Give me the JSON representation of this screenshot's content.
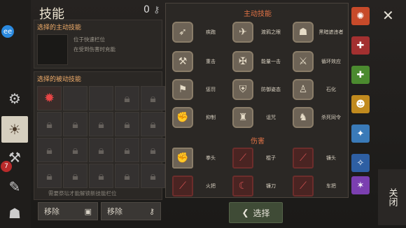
{
  "header": {
    "title": "技能",
    "count": "0"
  },
  "active": {
    "label": "选择的主动技能",
    "note1": "位于快速栏位",
    "note2": "在受到伤害时充能"
  },
  "passive": {
    "label": "选择的被动技能",
    "hint": "需要祭坛才能解锁新技能栏位",
    "remove1": "移除",
    "remove2": "移除"
  },
  "active_skills": {
    "title": "主动技能",
    "items": [
      "疾跑",
      "渡鸦之眼",
      "黑暗遮违者",
      "重击",
      "能量一击",
      "循环效应",
      "惩罚",
      "防御姿态",
      "石化",
      "抑制",
      "诅咒",
      "杀死同令"
    ]
  },
  "damage_skills": {
    "title": "伤害",
    "items": [
      "拳头",
      "棍子",
      "镰头",
      "火把",
      "镰刀",
      "车把"
    ]
  },
  "footer": {
    "select": "选择",
    "exit": "关闭"
  },
  "left_badge": "7"
}
